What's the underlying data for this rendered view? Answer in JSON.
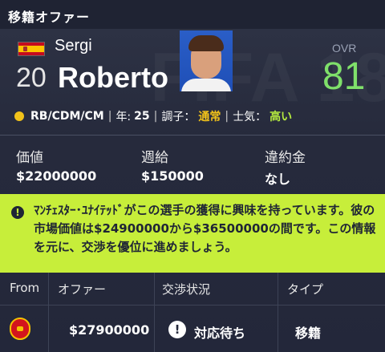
{
  "header": {
    "title": "移籍オファー"
  },
  "background_watermark": "FIFA 18",
  "player": {
    "first_name": "Sergi",
    "last_name": "Roberto",
    "number": "20",
    "ovr_label": "OVR",
    "ovr_value": "81",
    "nationality_flag": "spain-flag",
    "positions": "RB/CDM/CM",
    "age_label": "年:",
    "age": "25",
    "form_label": "調子：",
    "form_value": "通常",
    "morale_label": "士気：",
    "morale_value": "高い"
  },
  "stats": [
    {
      "label": "価値",
      "value": "$22000000"
    },
    {
      "label": "週給",
      "value": "$150000"
    },
    {
      "label": "違約金",
      "value": "なし"
    }
  ],
  "notice": {
    "icon": "info-icon",
    "text": "ﾏﾝﾁｪｽﾀｰ･ﾕﾅｲﾃｯﾄﾞがこの選手の獲得に興味を持っています。彼の市場価値は$24900000から$36500000の間です。この情報を元に、交渉を優位に進めましょう。"
  },
  "offer_table": {
    "headers": {
      "from": "From",
      "offer": "オファー",
      "status": "交渉状況",
      "type": "タイプ"
    },
    "row": {
      "club_icon": "manchester-united-crest-icon",
      "offer": "$27900000",
      "status_icon": "alert-icon",
      "status": "対応待ち",
      "type": "移籍"
    }
  },
  "colors": {
    "ovr": "#7fe06a",
    "form": "#f2c21a",
    "morale": "#b6ec3f",
    "notice_bg": "#c7ee3a"
  }
}
